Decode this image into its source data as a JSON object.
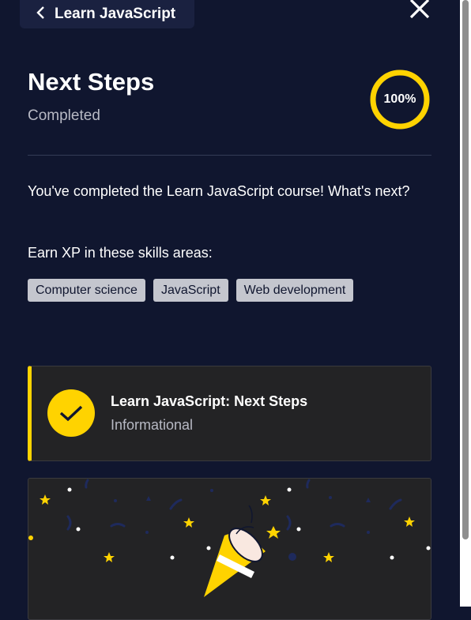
{
  "header": {
    "back_label": "Learn JavaScript",
    "back_icon": "chevron-left-icon",
    "close_icon": "close-icon"
  },
  "lesson": {
    "title": "Next Steps",
    "status": "Completed",
    "progress_label": "100%",
    "progress_percent": 100
  },
  "content": {
    "description": "You've completed the Learn JavaScript course! What's next?",
    "skills_heading": "Earn XP in these skills areas:",
    "skills": [
      "Computer science",
      "JavaScript",
      "Web development"
    ]
  },
  "next_item": {
    "title": "Learn JavaScript: Next Steps",
    "subtitle": "Informational",
    "icon": "checkmark-icon"
  },
  "celebration": {
    "icon": "party-popper-icon"
  },
  "colors": {
    "background": "#10162f",
    "accent": "#ffd300",
    "card": "#232325",
    "tag": "#c4c6ce"
  }
}
